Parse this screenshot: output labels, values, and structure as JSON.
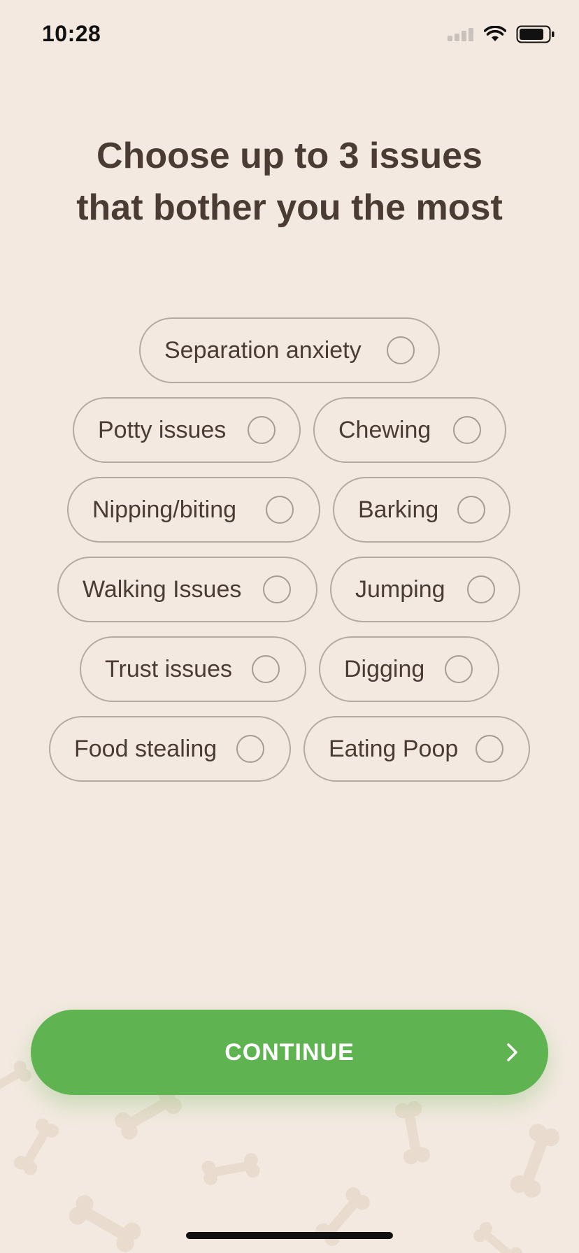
{
  "status_bar": {
    "time": "10:28"
  },
  "heading": {
    "line1": "Choose up to 3 issues",
    "line2": "that bother you the most"
  },
  "options": {
    "separation_anxiety": "Separation anxiety",
    "potty_issues": "Potty issues",
    "chewing": "Chewing",
    "nipping_biting": "Nipping/biting",
    "barking": "Barking",
    "walking_issues": "Walking Issues",
    "jumping": "Jumping",
    "trust_issues": "Trust issues",
    "digging": "Digging",
    "food_stealing": "Food stealing",
    "eating_poop": "Eating Poop"
  },
  "continue_button": {
    "label": "CONTINUE"
  },
  "colors": {
    "background": "#f3e9e0",
    "text": "#4a3c33",
    "accent": "#5fb350",
    "chip_border": "#b3aaa3"
  },
  "icons": {
    "signal": "cellular-signal-icon",
    "wifi": "wifi-icon",
    "battery": "battery-icon",
    "continue": "chevron-right-icon",
    "decoration": "bone-icon"
  }
}
